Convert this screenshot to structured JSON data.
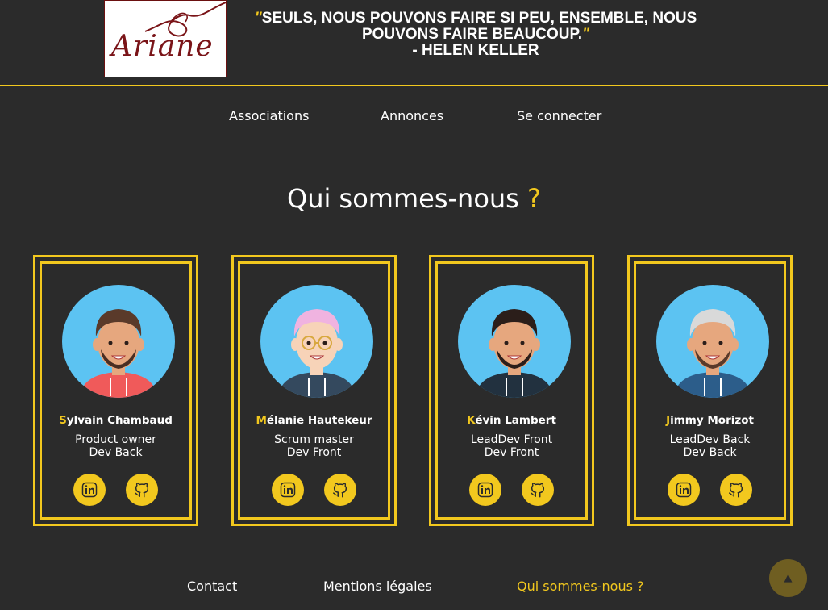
{
  "header": {
    "logo_text": "Ariane",
    "quote_line1": "SEULS, NOUS POUVONS FAIRE SI PEU, ENSEMBLE, NOUS",
    "quote_line2": "POUVONS FAIRE BEAUCOUP.",
    "quote_author": "- HELEN KELLER"
  },
  "nav": {
    "associations": "Associations",
    "annonces": "Annonces",
    "login": "Se connecter"
  },
  "page": {
    "title": "Qui sommes-nous",
    "title_mark": "?"
  },
  "team": [
    {
      "initial": "S",
      "name_rest": "ylvain Chambaud",
      "role1": "Product owner",
      "role2": "Dev Back",
      "hair": "#5a3a2a",
      "beard": "#4a2e22",
      "skin": "#e6a77e",
      "hoodie": "#f05a5a"
    },
    {
      "initial": "M",
      "name_rest": "élanie Hautekeur",
      "role1": "Scrum master",
      "role2": "Dev Front",
      "hair": "#f0b3e0",
      "beard": "",
      "skin": "#f7d3b8",
      "hoodie": "#34495e"
    },
    {
      "initial": "K",
      "name_rest": "évin Lambert",
      "role1": "LeadDev Front",
      "role2": "Dev Front",
      "hair": "#2b1e1a",
      "beard": "#2b1e1a",
      "skin": "#e6a77e",
      "hoodie": "#22313f"
    },
    {
      "initial": "J",
      "name_rest": "immy Morizot",
      "role1": "LeadDev Back",
      "role2": "Dev Back",
      "hair": "#d9d9d9",
      "beard": "#5a3a2a",
      "skin": "#e6a77e",
      "hoodie": "#2c5d8a"
    }
  ],
  "icons": {
    "linkedin": "linkedin-icon",
    "github": "github-icon",
    "back_to_top": "arrow-up-icon"
  },
  "footer": {
    "contact": "Contact",
    "legal": "Mentions légales",
    "about": "Qui sommes-nous ?"
  },
  "colors": {
    "accent": "#f2c81e",
    "background": "#2b2b2b",
    "avatar_bg": "#5cc3f2"
  }
}
